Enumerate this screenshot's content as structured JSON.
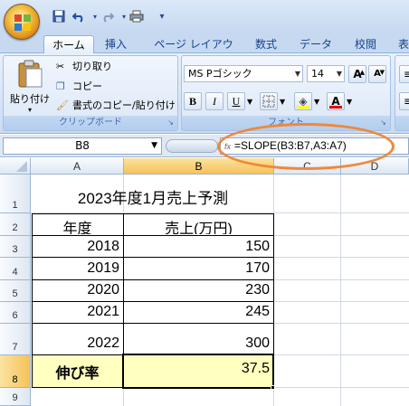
{
  "quick_access": {
    "save_icon": "save-icon",
    "undo_icon": "undo-icon",
    "redo_icon": "redo-icon",
    "print_icon": "print-icon",
    "customize": "▾"
  },
  "tabs": [
    {
      "label": "ホーム",
      "active": true
    },
    {
      "label": "挿入"
    },
    {
      "label": "ページ レイアウト"
    },
    {
      "label": "数式"
    },
    {
      "label": "データ"
    },
    {
      "label": "校閲"
    },
    {
      "label": "表"
    }
  ],
  "ribbon": {
    "clipboard": {
      "paste_label": "貼り付け",
      "cut_label": "切り取り",
      "copy_label": "コピー",
      "format_painter_label": "書式のコピー/貼り付け",
      "group_label": "クリップボード"
    },
    "font": {
      "font_name": "MS Pゴシック",
      "font_size": "14",
      "grow_label": "A",
      "shrink_label": "A",
      "bold_label": "B",
      "italic_label": "I",
      "underline_label": "U",
      "font_color_label": "A",
      "group_label": "フォント"
    }
  },
  "formula_bar": {
    "name_box": "B8",
    "fx_label": "fx",
    "formula": "=SLOPE(B3:B7,A3:A7)"
  },
  "columns": [
    "A",
    "B",
    "C",
    "D"
  ],
  "rows": [
    "1",
    "2",
    "3",
    "4",
    "5",
    "6",
    "7",
    "8",
    "9"
  ],
  "sheet": {
    "title": "2023年度1月売上予測",
    "header_year": "年度",
    "header_sales": "売上(万円)",
    "data": [
      {
        "year": "2018",
        "sales": "150"
      },
      {
        "year": "2019",
        "sales": "170"
      },
      {
        "year": "2020",
        "sales": "230"
      },
      {
        "year": "2021",
        "sales": "245"
      },
      {
        "year": "2022",
        "sales": "300"
      }
    ],
    "growth_label": "伸び率",
    "growth_value": "37.5"
  },
  "colors": {
    "highlight": "#f0883a",
    "yellow_fill": "#ffffc0",
    "selected_header": "#f6c25a"
  }
}
